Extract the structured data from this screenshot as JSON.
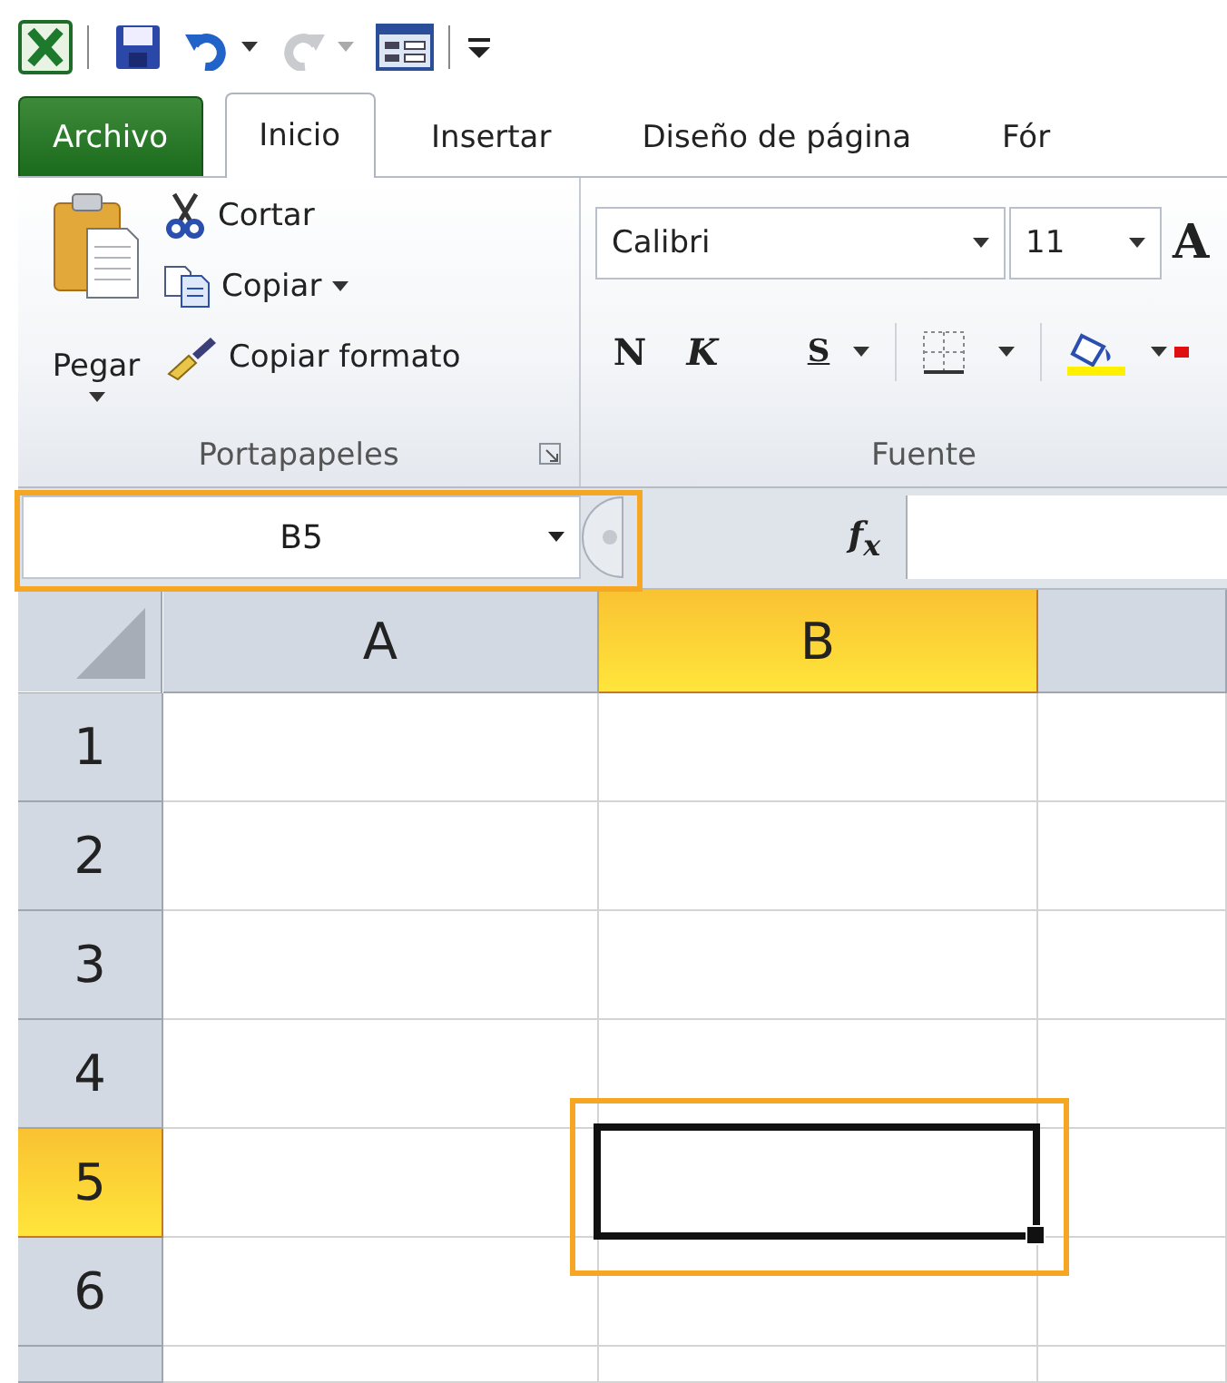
{
  "quick_access": [
    {
      "kind": "logo",
      "disabled": false
    },
    {
      "kind": "save",
      "disabled": false
    },
    {
      "kind": "undo",
      "disabled": false
    },
    {
      "kind": "redo",
      "disabled": true
    },
    {
      "kind": "form",
      "disabled": false
    },
    {
      "kind": "customize",
      "disabled": false
    }
  ],
  "tabs": [
    {
      "label": "Archivo",
      "kind": "file",
      "selected": false
    },
    {
      "label": "Inicio",
      "kind": "tab",
      "selected": true
    },
    {
      "label": "Insertar",
      "kind": "tab",
      "selected": false
    },
    {
      "label": "Diseño de página",
      "kind": "tab",
      "selected": false
    },
    {
      "label": "Fór",
      "kind": "tab",
      "selected": false
    }
  ],
  "ribbon": {
    "clipboard": {
      "paste_label": "Pegar",
      "cut_label": "Cortar",
      "copy_label": "Copiar",
      "format_painter_label": "Copiar formato",
      "group_label": "Portapapeles"
    },
    "font": {
      "font_name": "Calibri",
      "font_size": "11",
      "grow_label": "A",
      "bold_label": "N",
      "italic_label": "K",
      "underline_label": "S",
      "group_label": "Fuente"
    }
  },
  "name_box": {
    "value": "B5",
    "highlighted": true
  },
  "formula_bar": {
    "function_label": "f$_{x}$"
  },
  "grid": {
    "columns": [
      {
        "label": "A",
        "selected": false
      },
      {
        "label": "B",
        "selected": true
      },
      {
        "selected": false
      }
    ],
    "rows": [
      {
        "label": "1",
        "selected": false,
        "cells": [
          {
            "selected": false,
            "highlighted": false
          },
          {
            "selected": false,
            "highlighted": false
          },
          {
            "selected": false,
            "highlighted": false
          }
        ]
      },
      {
        "label": "2",
        "selected": false,
        "cells": [
          {
            "selected": false,
            "highlighted": false
          },
          {
            "selected": false,
            "highlighted": false
          },
          {
            "selected": false,
            "highlighted": false
          }
        ]
      },
      {
        "label": "3",
        "selected": false,
        "cells": [
          {
            "selected": false,
            "highlighted": false
          },
          {
            "selected": false,
            "highlighted": false
          },
          {
            "selected": false,
            "highlighted": false
          }
        ]
      },
      {
        "label": "4",
        "selected": false,
        "cells": [
          {
            "selected": false,
            "highlighted": false
          },
          {
            "selected": false,
            "highlighted": false
          },
          {
            "selected": false,
            "highlighted": false
          }
        ]
      },
      {
        "label": "5",
        "selected": true,
        "cells": [
          {
            "selected": false,
            "highlighted": false
          },
          {
            "selected": true,
            "highlighted": true
          },
          {
            "selected": false,
            "highlighted": false
          }
        ]
      },
      {
        "label": "6",
        "selected": false,
        "cells": [
          {
            "selected": false,
            "highlighted": false
          },
          {
            "selected": false,
            "highlighted": false
          },
          {
            "selected": false,
            "highlighted": false
          }
        ]
      }
    ]
  }
}
